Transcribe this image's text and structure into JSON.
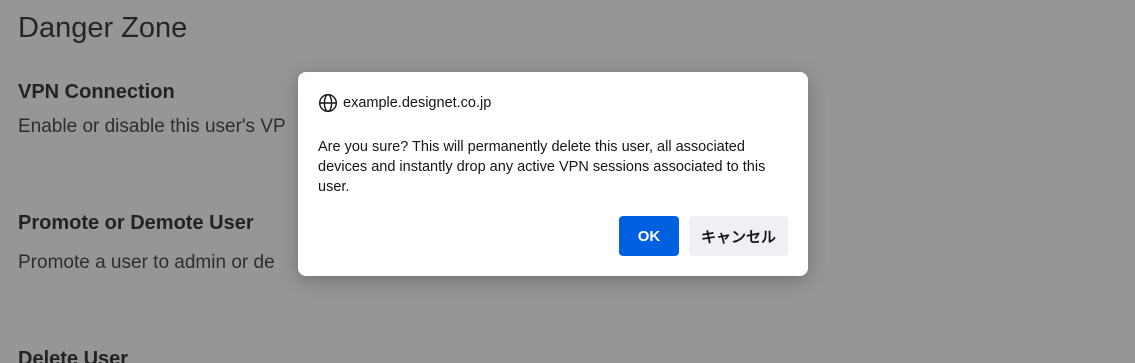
{
  "page": {
    "title": "Danger Zone",
    "sections": [
      {
        "title": "VPN Connection",
        "description": "Enable or disable this user's VP"
      },
      {
        "title": "Promote or Demote User",
        "description": "Promote a user to admin or de"
      },
      {
        "title": "Delete User"
      }
    ]
  },
  "dialog": {
    "origin": "example.designet.co.jp",
    "origin_icon": "globe-icon",
    "message": "Are you sure? This will permanently delete this user, all associated devices and instantly drop any active VPN sessions associated to this user.",
    "ok_label": "OK",
    "cancel_label": "キャンセル"
  },
  "colors": {
    "overlay": "#8f8f93",
    "ok_button": "#0060df",
    "cancel_button": "#f0f0f4",
    "dialog_background": "#ffffff"
  }
}
